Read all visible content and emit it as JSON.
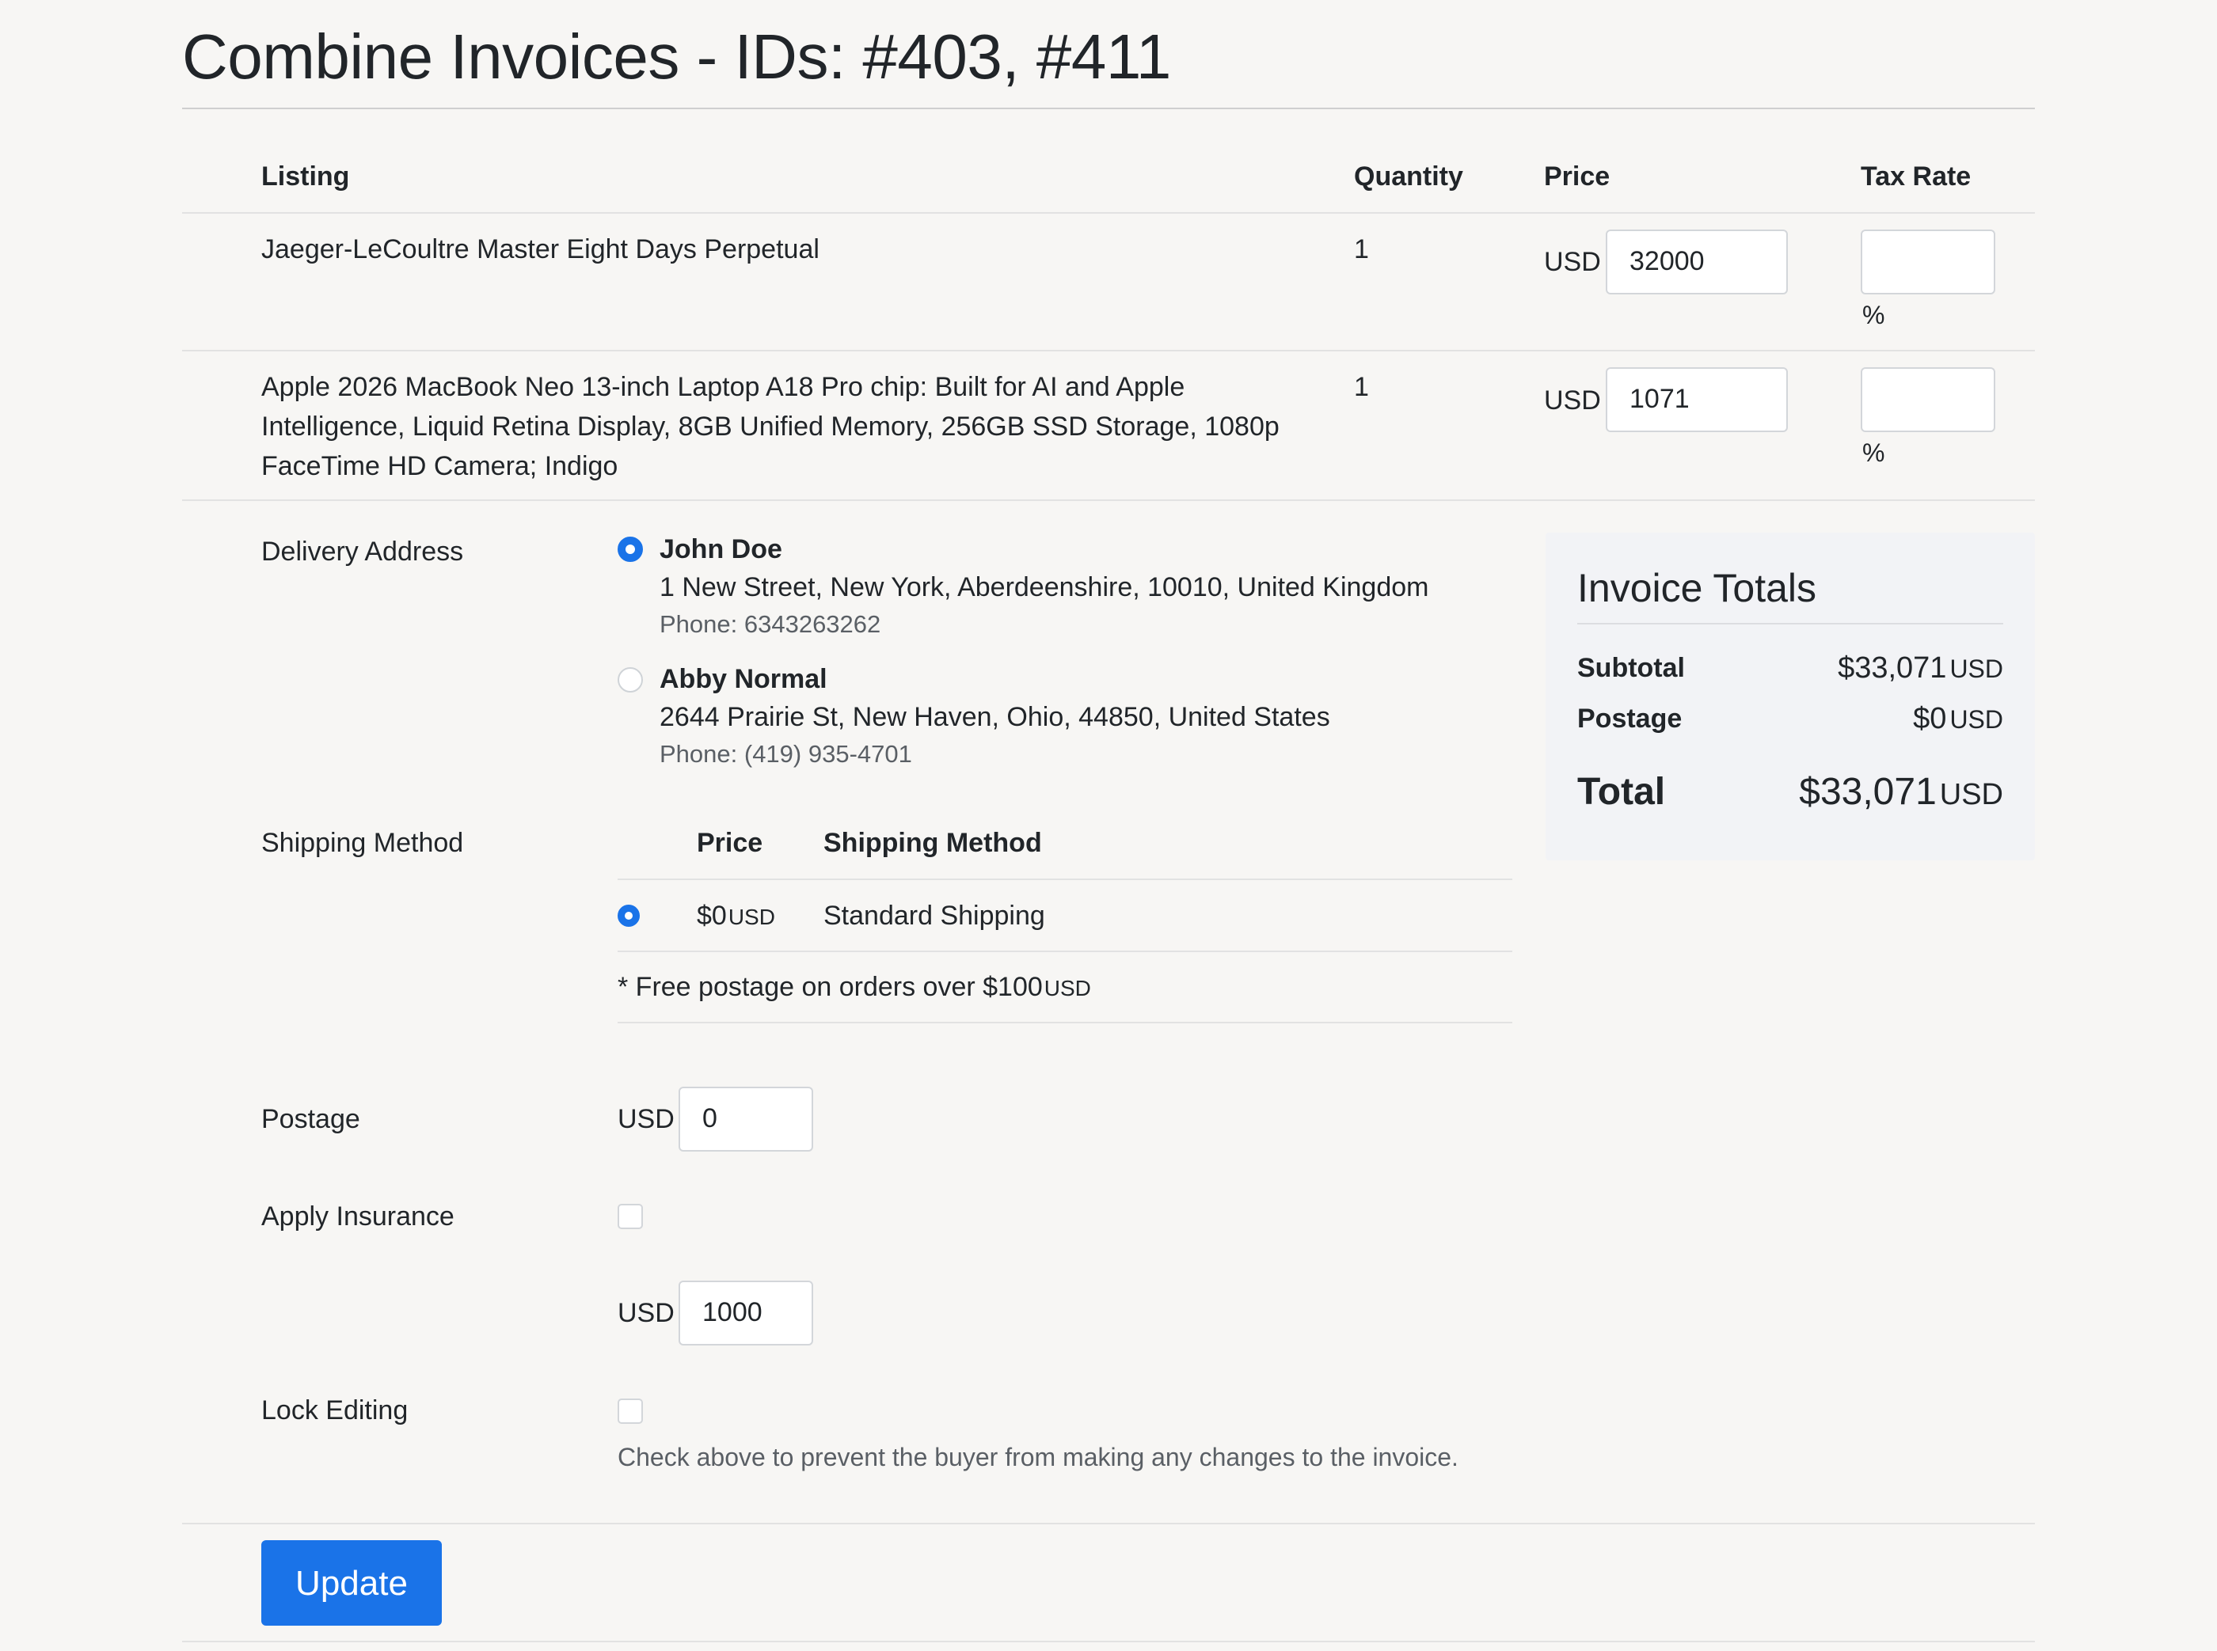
{
  "page": {
    "title": "Combine Invoices - IDs: #403, #411"
  },
  "table": {
    "headers": {
      "listing": "Listing",
      "quantity": "Quantity",
      "price": "Price",
      "tax_rate": "Tax Rate"
    },
    "rows": [
      {
        "listing": "Jaeger-LeCoultre Master Eight Days Perpetual",
        "quantity": "1",
        "currency": "USD",
        "price": "32000",
        "tax_rate": "",
        "tax_unit": "%"
      },
      {
        "listing_lines": [
          "Apple 2026 MacBook Neo 13-inch Laptop A18 Pro chip: Built for AI and Apple",
          "Intelligence, Liquid Retina Display, 8GB Unified Memory, 256GB SSD Storage, 1080p",
          "FaceTime HD Camera; Indigo"
        ],
        "quantity": "1",
        "currency": "USD",
        "price": "1071",
        "tax_rate": "",
        "tax_unit": "%"
      }
    ]
  },
  "delivery": {
    "label": "Delivery Address",
    "addresses": [
      {
        "name": "John Doe",
        "line": "1 New Street, New York, Aberdeenshire, 10010, United Kingdom",
        "phone": "Phone: 6343263262",
        "selected": true
      },
      {
        "name": "Abby Normal",
        "line": "2644 Prairie St, New Haven, Ohio, 44850, United States",
        "phone": "Phone: (419) 935-4701",
        "selected": false
      }
    ]
  },
  "shipping": {
    "label": "Shipping Method",
    "headers": {
      "price": "Price",
      "method": "Shipping Method"
    },
    "options": [
      {
        "price": "$0",
        "currency": "USD",
        "method": "Standard Shipping",
        "selected": true
      }
    ],
    "note": "* Free postage on orders over $100",
    "note_currency": "USD"
  },
  "postage": {
    "label": "Postage",
    "currency": "USD",
    "value": "0"
  },
  "insurance": {
    "label": "Apply Insurance",
    "checked": false,
    "currency": "USD",
    "value": "1000"
  },
  "lock": {
    "label": "Lock Editing",
    "checked": false,
    "help": "Check above to prevent the buyer from making any changes to the invoice."
  },
  "totals": {
    "title": "Invoice Totals",
    "subtotal_label": "Subtotal",
    "subtotal_value": "$33,071",
    "subtotal_currency": "USD",
    "postage_label": "Postage",
    "postage_value": "$0",
    "postage_currency": "USD",
    "total_label": "Total",
    "total_value": "$33,071",
    "total_currency": "USD"
  },
  "actions": {
    "update_label": "Update"
  },
  "colors": {
    "accent": "#1a73e8",
    "background": "#f7f6f4",
    "panel": "#f2f3f6"
  }
}
